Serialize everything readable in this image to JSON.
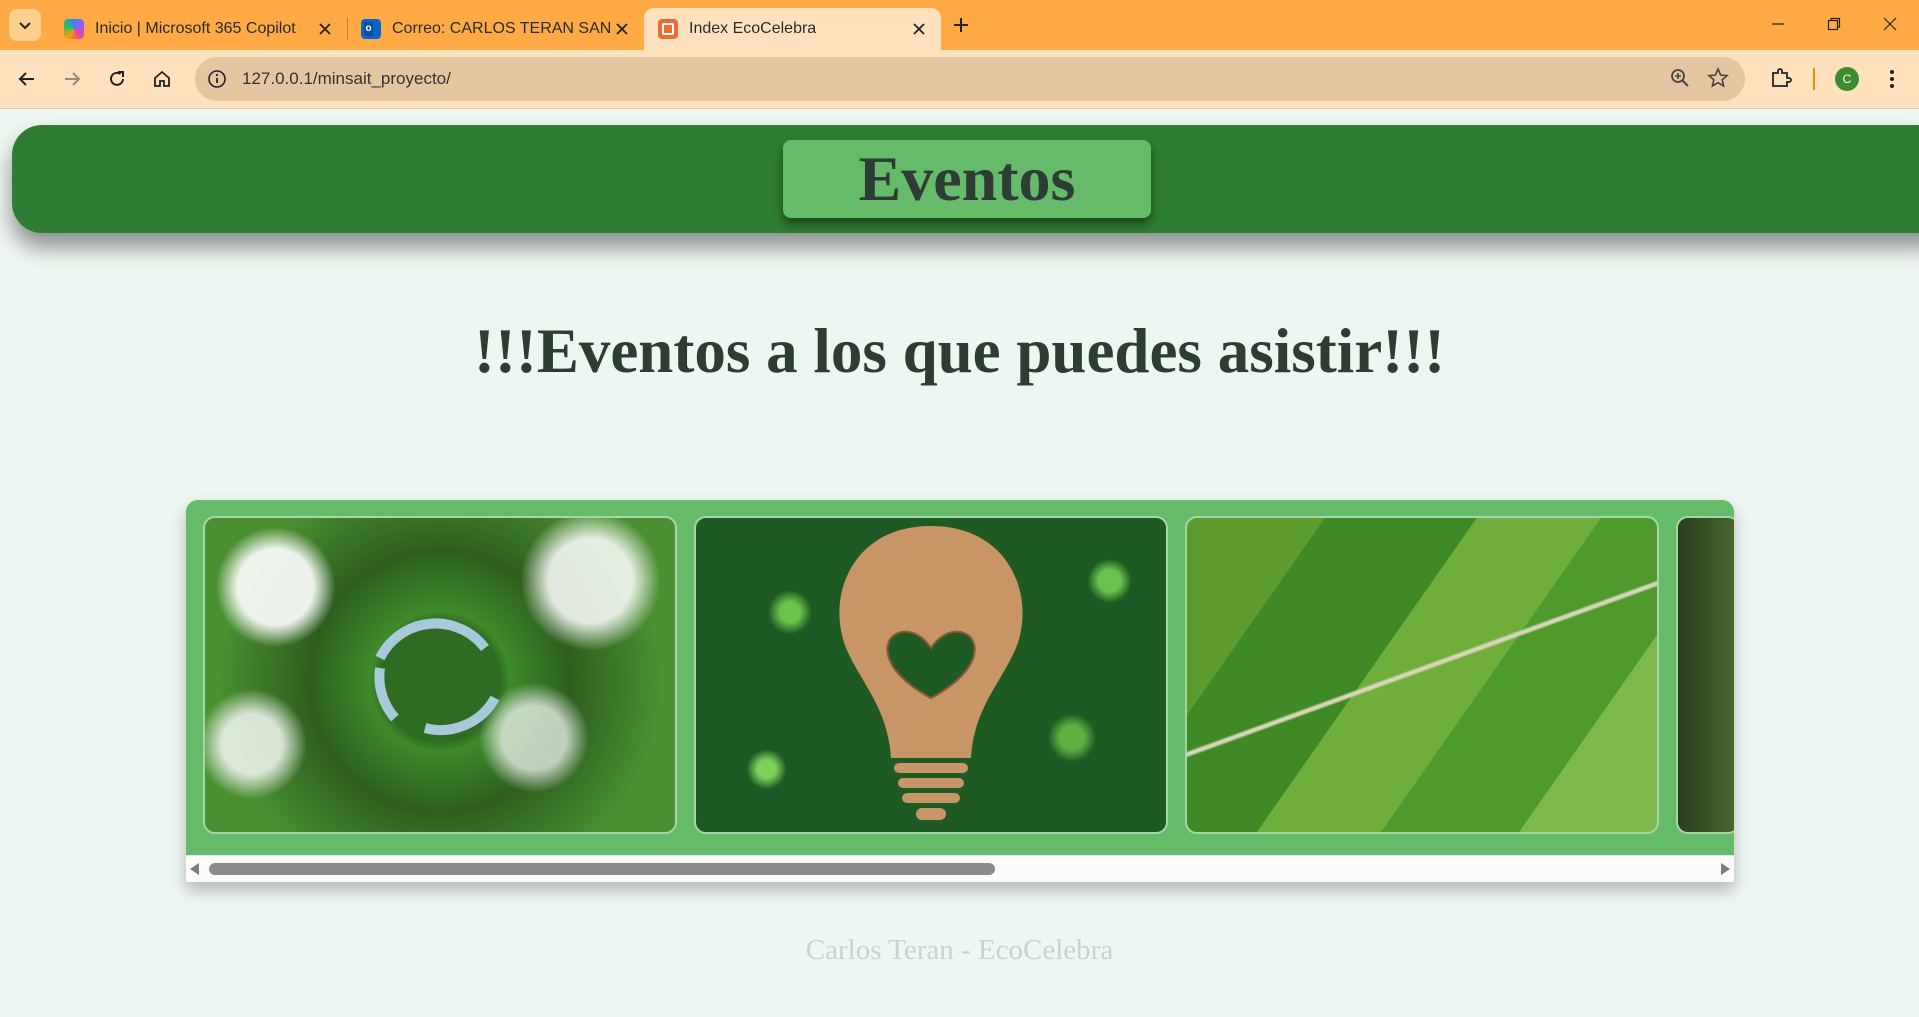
{
  "browser": {
    "tabs": [
      {
        "title": "Inicio | Microsoft 365 Copilot",
        "icon": "copilot-icon",
        "active": false
      },
      {
        "title": "Correo: CARLOS TERAN SANCHEZ - Outlook",
        "icon": "outlook-icon",
        "active": false
      },
      {
        "title": "Index EcoCelebra",
        "icon": "xampp-icon",
        "active": true
      }
    ],
    "address": "127.0.0.1/minsait_proyecto/",
    "profile_initial": "C"
  },
  "page": {
    "header_title": "Eventos",
    "heading": "!!!Eventos a los que puedes asistir!!!",
    "gallery": {
      "images": [
        {
          "name": "forest-recycle-image",
          "alt": "Bosque con símbolo de reciclaje"
        },
        {
          "name": "wood-lightbulb-heart-image",
          "alt": "Bombilla de madera con corazón sobre hojas"
        },
        {
          "name": "green-fields-image",
          "alt": "Campos verdes con camino"
        },
        {
          "name": "partial-fourth-image",
          "alt": ""
        }
      ],
      "scroll_position": 0
    },
    "footer": "Carlos Teran - EcoCelebra"
  },
  "colors": {
    "tabstrip": "#ffaa44",
    "toolbar": "#ffe2bd",
    "header": "#2e7d32",
    "header_box": "#66bb6a",
    "page_bg": "#eef6f1"
  }
}
